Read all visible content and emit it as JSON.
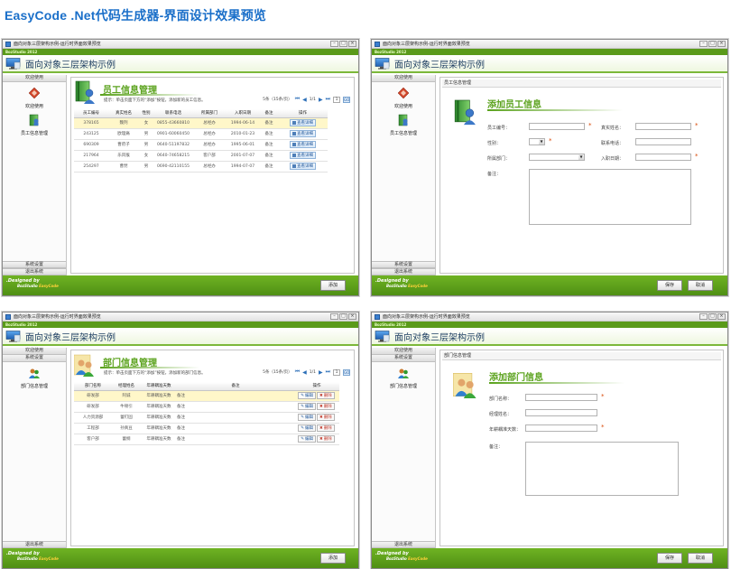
{
  "page_title": "EasyCode .Net代码生成器-界面设计效果预览",
  "window_title": "面向对象三层架构示例-运行时界面效果预览",
  "brand_strip": "BozStudio 2012",
  "app_header": "面向对象三层架构示例",
  "footer": {
    "designed_by": ".Designed by",
    "studio": "BozStudio",
    "product": "EasyCode",
    "add_label": "添加",
    "save_label": "保存",
    "cancel_label": "取消"
  },
  "sidebar": {
    "welcome": "欢迎使用",
    "system_settings": "系统设置",
    "exit": "退出系统",
    "item_welcome": "欢迎使用",
    "item_employee": "员工信息管理",
    "item_department": "部门信息管理"
  },
  "employee_list": {
    "title": "员工信息管理",
    "hint": "提示：单击页面下方的“添加”按钮，添加新的员工信息。",
    "record_info": "5条（15条/页）",
    "page_info": "1/1",
    "page_value": "1",
    "go": "GO",
    "columns": [
      "员工编号",
      "真实姓名",
      "性别",
      "联系电话",
      "所属部门",
      "入职日期",
      "备注",
      "操作"
    ],
    "rows": [
      [
        "378165",
        "魏列",
        "女",
        "0855-43660810",
        "总经办",
        "1994-06-14",
        "备注",
        "查看详细"
      ],
      [
        "243125",
        "欧理痛",
        "男",
        "0901-60060450",
        "总经办",
        "2010-01-23",
        "备注",
        "查看详细"
      ],
      [
        "690309",
        "曹府子",
        "男",
        "0640-51197832",
        "总经办",
        "1995-06-01",
        "备注",
        "查看详细"
      ],
      [
        "217964",
        "乐风猴",
        "女",
        "0640-74658215",
        "客户部",
        "2001-07-07",
        "备注",
        "查看详细"
      ],
      [
        "254297",
        "曹琵",
        "男",
        "0690-42110155",
        "总经办",
        "1994-07-07",
        "备注",
        "查看详细"
      ]
    ]
  },
  "employee_form": {
    "group": "员工信息管理",
    "title": "添加员工信息",
    "emp_no": "员工编号：",
    "real_name": "真实姓名：",
    "gender": "性别：",
    "phone": "联系电话：",
    "department": "所属部门：",
    "hire_date": "入职日期：",
    "remark": "备注："
  },
  "department_list": {
    "title": "部门信息管理",
    "hint": "提示：单击页面下方的“添加”按钮，添加新的部门信息。",
    "record_info": "5条（15条/页）",
    "page_info": "1/1",
    "page_value": "1",
    "go": "GO",
    "columns": [
      "部门名称",
      "经理姓名",
      "年耕耦准天数",
      "备注",
      "操作"
    ],
    "rows": [
      [
        "研发部",
        "阿诚",
        "年耕耦准天数",
        "备注"
      ],
      [
        "研发部",
        "牛顿引",
        "年耕耦准天数",
        "备注"
      ],
      [
        "人力资源部",
        "蕾钉固",
        "年耕耦准天数",
        "备注"
      ],
      [
        "工程部",
        "孙真豆",
        "年耕耦准天数",
        "备注"
      ],
      [
        "客户部",
        "蕾纲",
        "年耕耦准天数",
        "备注"
      ]
    ],
    "edit": "编辑",
    "delete": "删除"
  },
  "department_form": {
    "group": "部门信息管理",
    "title": "添加部门信息",
    "dept_name": "部门名称：",
    "manager_name": "经理姓名：",
    "days": "年耕耦准天数：",
    "remark": "备注："
  },
  "colors": {
    "brand_green": "#5aa21c",
    "header_title": "#1f3f63",
    "page_title": "#1a6fc9",
    "required_star": "#d94b0a",
    "highlight_row": "#fff7c9"
  }
}
